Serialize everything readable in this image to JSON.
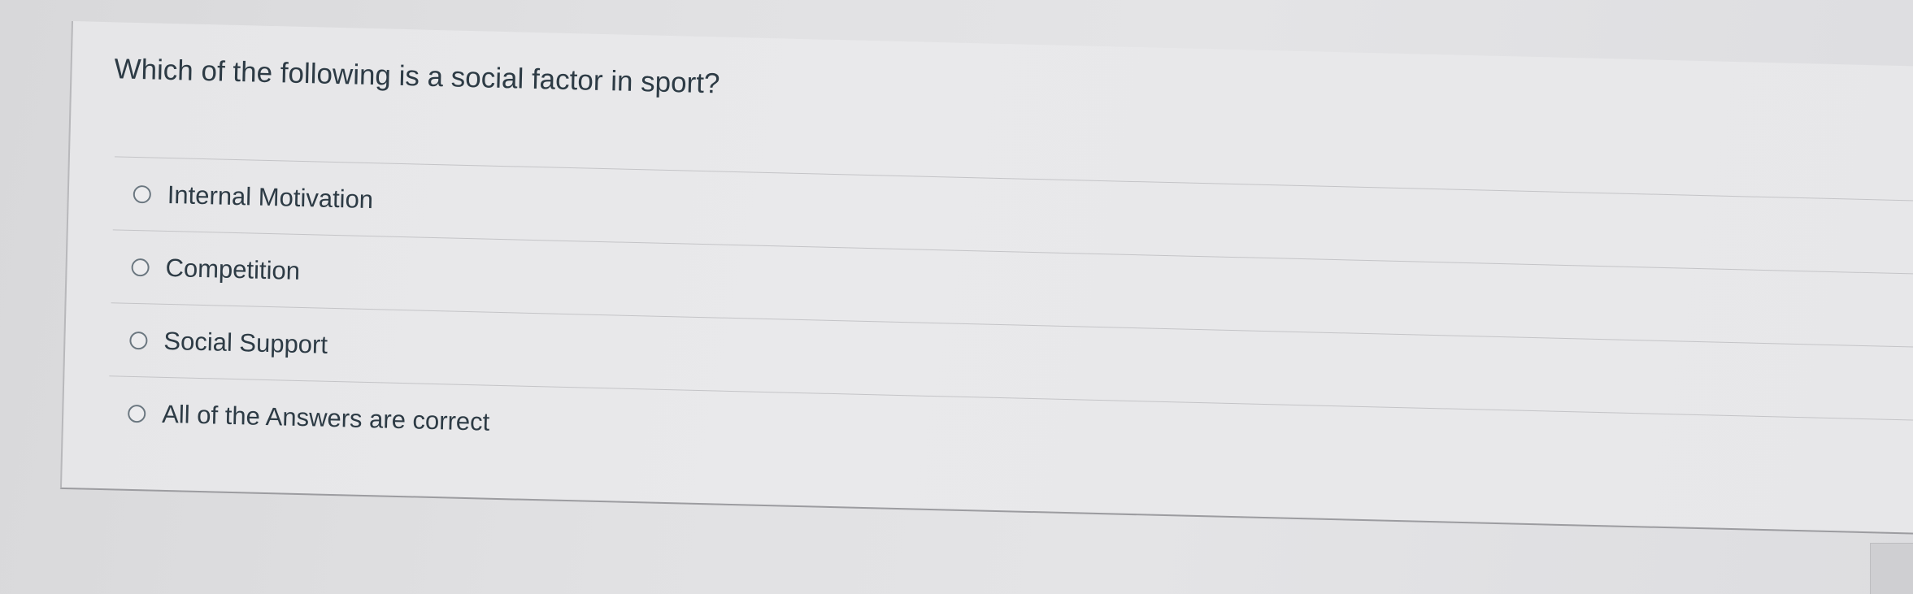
{
  "question": {
    "text": "Which of the following is a social factor in sport?"
  },
  "answers": [
    {
      "label": "Internal Motivation",
      "selected": false
    },
    {
      "label": "Competition",
      "selected": false
    },
    {
      "label": "Social Support",
      "selected": false
    },
    {
      "label": "All of the Answers are correct",
      "selected": false
    }
  ],
  "colors": {
    "text": "#2d3b45",
    "radio_border": "#6b7780",
    "divider": "#c4c4c7"
  }
}
